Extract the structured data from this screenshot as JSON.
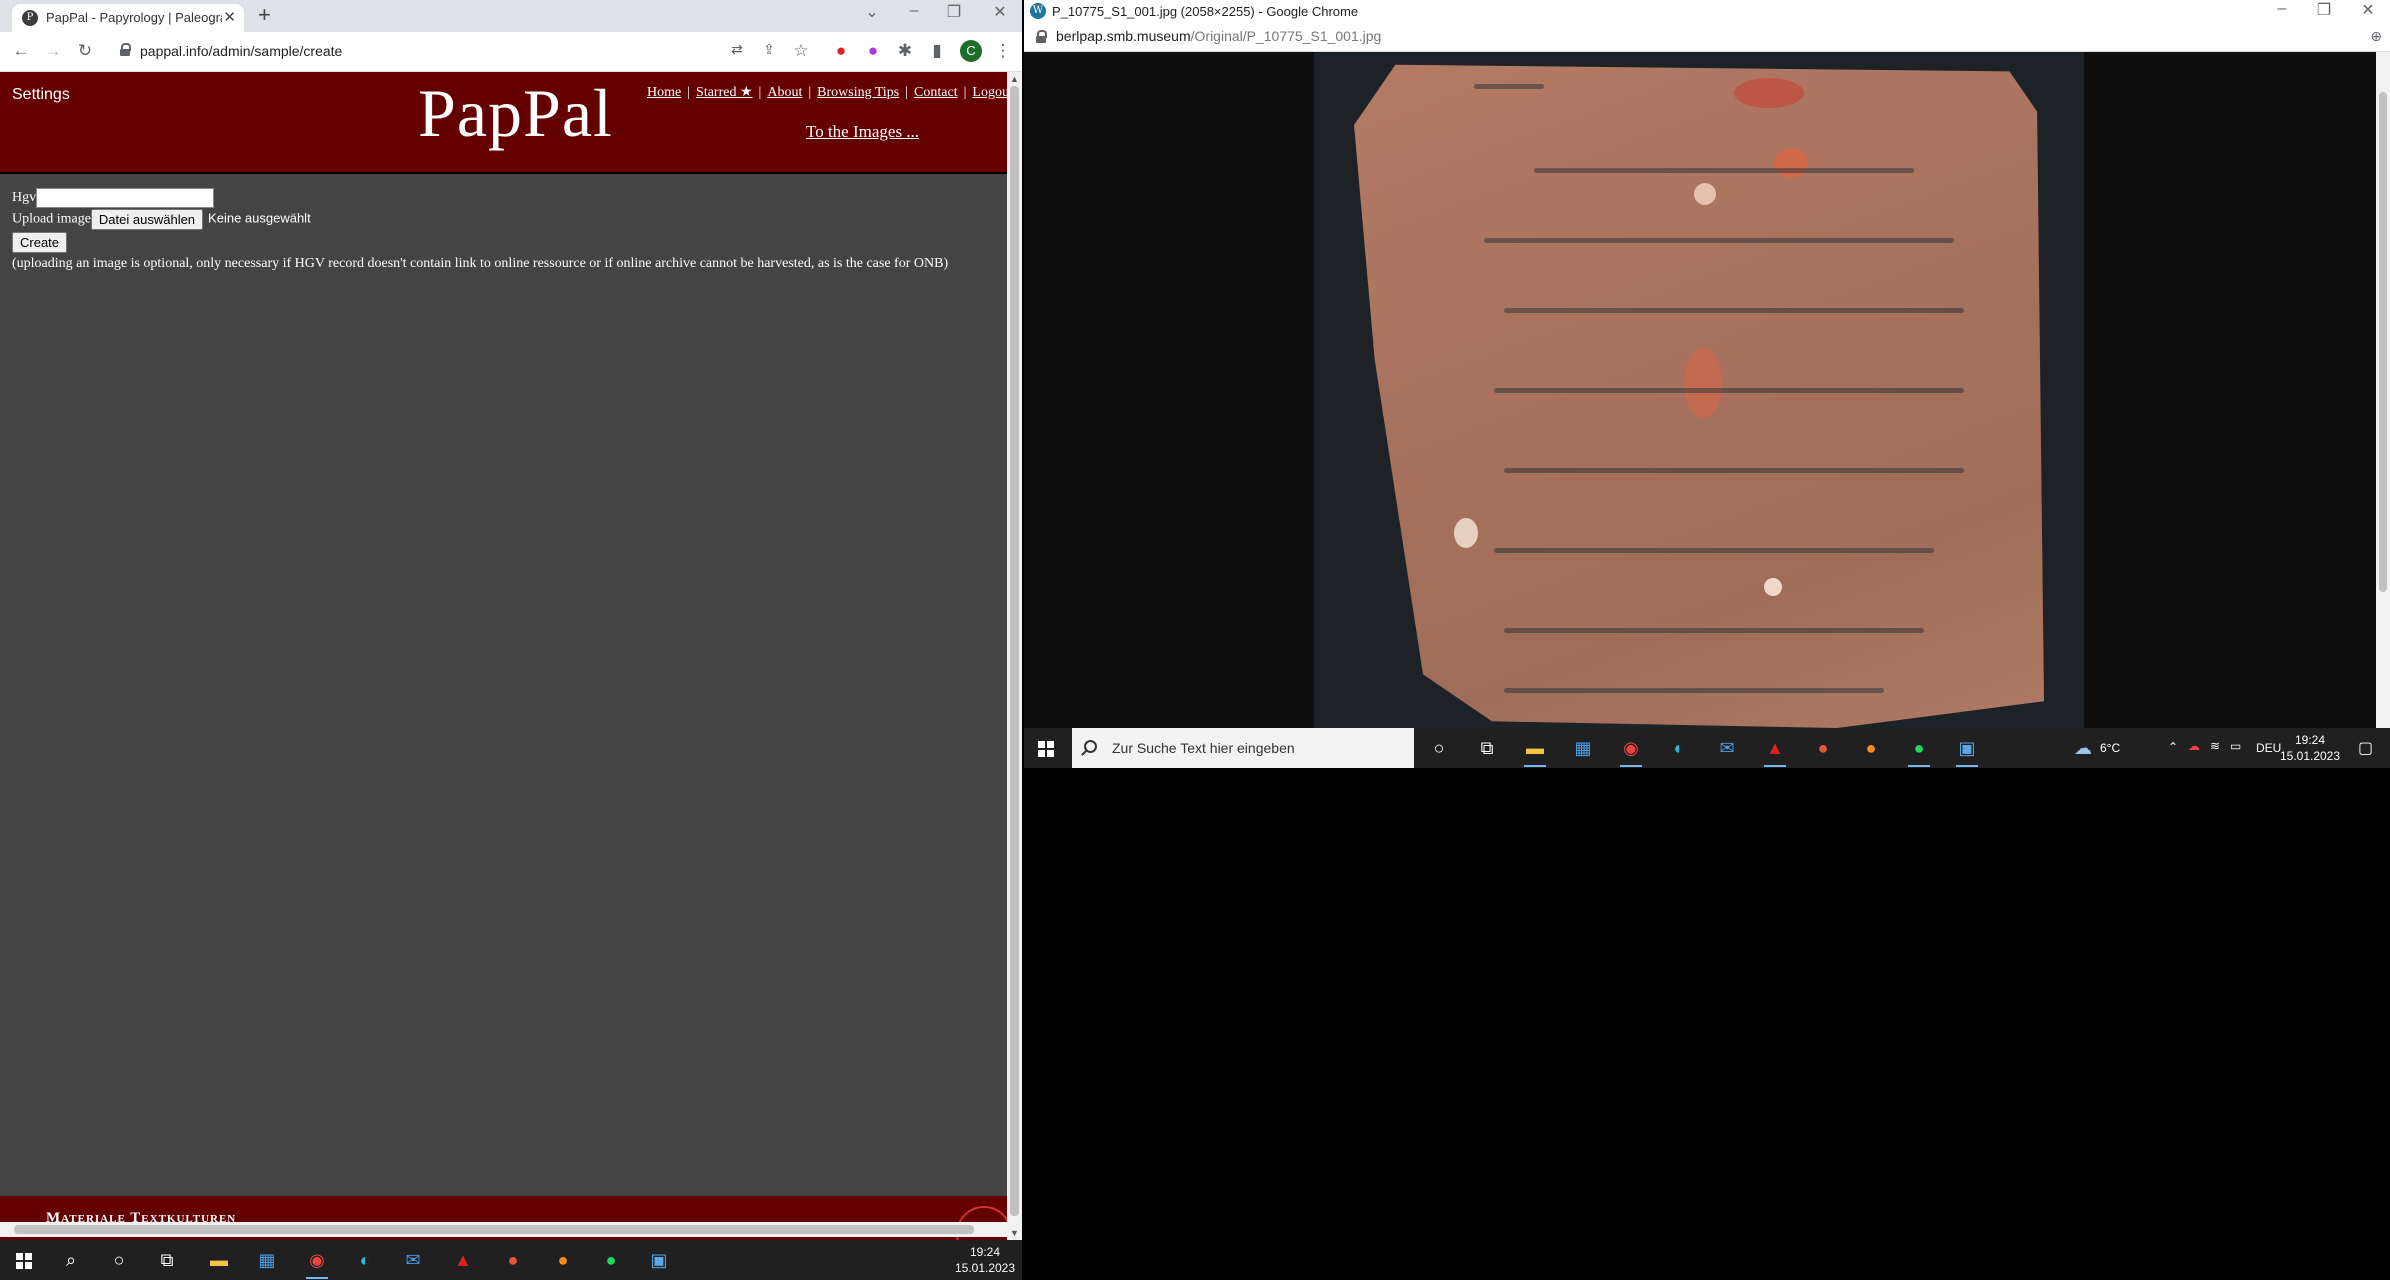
{
  "left_browser": {
    "tab_title": "PapPal - Papyrology | Paleograph",
    "url": "pappal.info/admin/sample/create",
    "profile_initial": "C",
    "site": {
      "settings_label": "Settings",
      "logo": "PapPal",
      "nav": [
        "Home",
        "Starred ★",
        "About",
        "Browsing Tips",
        "Contact",
        "Logout"
      ],
      "to_images": "To the Images ...",
      "form": {
        "hgv_label": "Hgv",
        "hgv_value": "",
        "upload_label": "Upload image",
        "file_button": "Datei auswählen",
        "file_status": "Keine ausgewählt",
        "create_button": "Create",
        "note": "(uploading an image is optional, only necessary if HGV record doesn't contain link to online ressource or if online archive cannot be harvested, as is the case for ONB)"
      },
      "footer_text": "Materiale Textkulturen"
    }
  },
  "right_browser": {
    "window_title": "P_10775_S1_001.jpg (2058×2255) - Google Chrome",
    "url_host": "berlpap.smb.museum",
    "url_path": "/Original/P_10775_S1_001.jpg"
  },
  "right_taskbar": {
    "search_placeholder": "Zur Suche Text hier eingeben",
    "weather": "6°C",
    "language": "DEU",
    "time": "19:24",
    "date": "15.01.2023"
  },
  "left_taskbar": {
    "time": "19:24",
    "date": "15.01.2023"
  },
  "colors": {
    "header_bg": "#650000",
    "page_bg": "#444444",
    "taskbar_bg": "#202020"
  }
}
